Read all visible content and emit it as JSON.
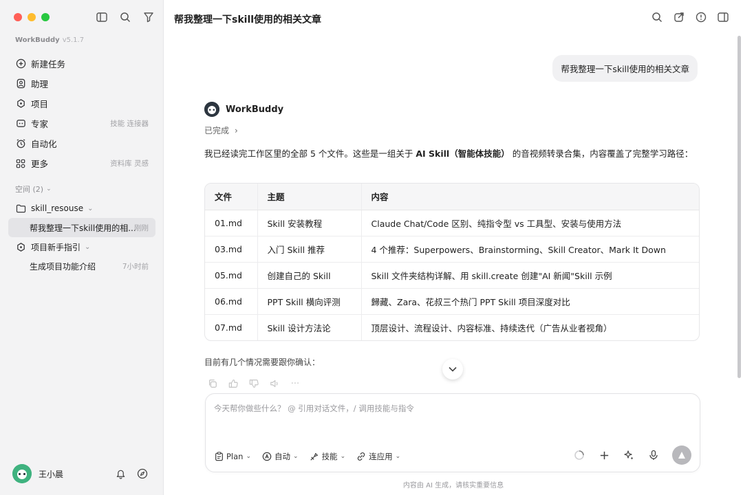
{
  "sidebar": {
    "brand": "WorkBuddy",
    "version": "v5.1.7",
    "nav": [
      {
        "label": "新建任务",
        "icon": "plus-circle-icon",
        "hint": ""
      },
      {
        "label": "助理",
        "icon": "assistant-icon",
        "hint": ""
      },
      {
        "label": "项目",
        "icon": "project-icon",
        "hint": ""
      },
      {
        "label": "专家",
        "icon": "expert-icon",
        "hint": "技能 连接器"
      },
      {
        "label": "自动化",
        "icon": "alarm-clock-icon",
        "hint": ""
      },
      {
        "label": "更多",
        "icon": "grid-icon",
        "hint": "资料库 灵感"
      }
    ],
    "space_header": "空间 (2)",
    "projects": [
      {
        "label": "skill_resouse",
        "type": "folder"
      },
      {
        "label": "帮我整理一下skill使用的相...",
        "time": "刚刚",
        "type": "task"
      },
      {
        "label": "项目新手指引",
        "type": "folder"
      },
      {
        "label": "生成项目功能介绍",
        "time": "7小时前",
        "type": "task"
      }
    ],
    "user_name": "王小晨"
  },
  "main": {
    "title": "帮我整理一下skill使用的相关文章",
    "user_message": "帮我整理一下skill使用的相关文章",
    "bot_name": "WorkBuddy",
    "status": "已完成",
    "intro_prefix": "我已经读完工作区里的全部 5 个文件。这些是一组关于 ",
    "intro_bold": "AI Skill（智能体技能）",
    "intro_suffix": " 的音视频转录合集，内容覆盖了完整学习路径：",
    "table": {
      "headers": [
        "文件",
        "主题",
        "内容"
      ],
      "rows": [
        [
          "01.md",
          "Skill 安装教程",
          "Claude Chat/Code 区别、纯指令型 vs 工具型、安装与使用方法"
        ],
        [
          "03.md",
          "入门 Skill 推荐",
          "4 个推荐：Superpowers、Brainstorming、Skill Creator、Mark It Down"
        ],
        [
          "05.md",
          "创建自己的 Skill",
          "Skill 文件夹结构详解、用 skill.create 创建\"AI 新闻\"Skill 示例"
        ],
        [
          "06.md",
          "PPT Skill 横向评测",
          "歸藏、Zara、花叔三个热门 PPT Skill 项目深度对比"
        ],
        [
          "07.md",
          "Skill 设计方法论",
          "顶层设计、流程设计、内容标准、持续迭代（广告从业者视角）"
        ]
      ]
    },
    "confirm_text": "目前有几个情况需要跟你确认：",
    "composer": {
      "placeholder": "今天帮你做些什么？ @ 引用对话文件，/ 调用技能与指令",
      "tools": [
        "Plan",
        "自动",
        "技能",
        "连应用"
      ]
    },
    "footer_note": "内容由 AI 生成，请核实重要信息"
  },
  "colors": {
    "sidebar_bg": "#f3f3f4",
    "avatar_green": "#3fb27f",
    "send_button": "#b8b8bc"
  }
}
